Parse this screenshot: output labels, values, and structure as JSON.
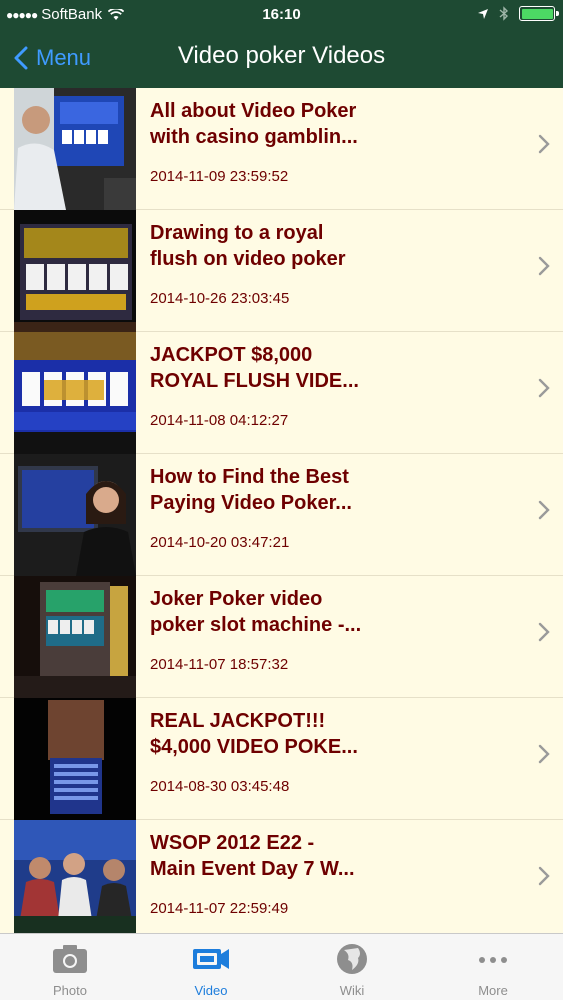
{
  "status": {
    "carrier": "SoftBank",
    "time": "16:10"
  },
  "nav": {
    "back_label": "Menu",
    "title": "Video poker Videos"
  },
  "videos": [
    {
      "title_line1": "All about Video Poker",
      "title_line2": "with casino gamblin...",
      "date": "2014-11-09 23:59:52"
    },
    {
      "title_line1": "Drawing to a royal",
      "title_line2": "flush on video poker",
      "date": "2014-10-26 23:03:45"
    },
    {
      "title_line1": "JACKPOT $8,000",
      "title_line2": "ROYAL FLUSH VIDE...",
      "date": "2014-11-08 04:12:27"
    },
    {
      "title_line1": "How to Find the Best",
      "title_line2": "Paying Video Poker...",
      "date": "2014-10-20 03:47:21"
    },
    {
      "title_line1": "Joker Poker video",
      "title_line2": "poker slot machine -...",
      "date": "2014-11-07 18:57:32"
    },
    {
      "title_line1": "REAL JACKPOT!!!",
      "title_line2": "$4,000 VIDEO POKE...",
      "date": "2014-08-30 03:45:48"
    },
    {
      "title_line1": "WSOP 2012 E22 -",
      "title_line2": "Main Event Day 7 W...",
      "date": "2014-11-07 22:59:49"
    }
  ],
  "tabs": [
    {
      "label": "Photo",
      "icon": "camera-icon"
    },
    {
      "label": "Video",
      "icon": "video-camera-icon",
      "active": true
    },
    {
      "label": "Wiki",
      "icon": "globe-icon"
    },
    {
      "label": "More",
      "icon": "more-dots-icon"
    }
  ],
  "colors": {
    "nav_bg": "#1e4a33",
    "accent": "#1d7ddc",
    "row_bg": "#fffbe4",
    "title_text": "#6e0000"
  }
}
